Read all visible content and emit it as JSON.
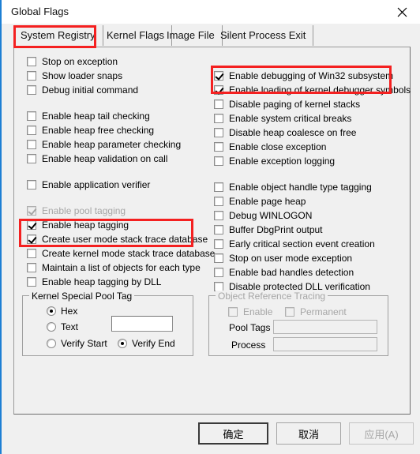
{
  "window": {
    "title": "Global Flags",
    "close_icon": "close-icon"
  },
  "tabs": [
    {
      "label": "System Registry",
      "selected": true
    },
    {
      "label": "Kernel Flags",
      "selected": false
    },
    {
      "label": "Image File",
      "selected": false
    },
    {
      "label": "Silent Process Exit",
      "selected": false
    }
  ],
  "left_column": [
    {
      "label": "Stop on exception",
      "checked": false,
      "enabled": true
    },
    {
      "label": "Show loader snaps",
      "checked": false,
      "enabled": true
    },
    {
      "label": "Debug initial command",
      "checked": false,
      "enabled": true
    },
    {
      "label": "Enable heap tail checking",
      "checked": false,
      "enabled": true
    },
    {
      "label": "Enable heap free checking",
      "checked": false,
      "enabled": true
    },
    {
      "label": "Enable heap parameter checking",
      "checked": false,
      "enabled": true
    },
    {
      "label": "Enable heap validation on call",
      "checked": false,
      "enabled": true
    },
    {
      "label": "Enable application verifier",
      "checked": false,
      "enabled": true
    },
    {
      "label": "Enable pool tagging",
      "checked": true,
      "enabled": false
    },
    {
      "label": "Enable heap tagging",
      "checked": true,
      "enabled": true
    },
    {
      "label": "Create user mode stack trace database",
      "checked": true,
      "enabled": true
    },
    {
      "label": "Create kernel mode stack trace database",
      "checked": false,
      "enabled": true
    },
    {
      "label": "Maintain a list of objects for each type",
      "checked": false,
      "enabled": true
    },
    {
      "label": "Enable heap tagging by DLL",
      "checked": false,
      "enabled": true
    }
  ],
  "right_column": [
    {
      "label": "Enable debugging of Win32 subsystem",
      "checked": true,
      "enabled": true
    },
    {
      "label": "Enable loading of kernel debugger symbols",
      "checked": true,
      "enabled": true
    },
    {
      "label": "Disable paging of kernel stacks",
      "checked": false,
      "enabled": true
    },
    {
      "label": "Enable system critical breaks",
      "checked": false,
      "enabled": true
    },
    {
      "label": "Disable heap coalesce on free",
      "checked": false,
      "enabled": true
    },
    {
      "label": "Enable close exception",
      "checked": false,
      "enabled": true
    },
    {
      "label": "Enable exception logging",
      "checked": false,
      "enabled": true
    },
    {
      "label": "Enable object handle type tagging",
      "checked": false,
      "enabled": true
    },
    {
      "label": "Enable page heap",
      "checked": false,
      "enabled": true
    },
    {
      "label": "Debug WINLOGON",
      "checked": false,
      "enabled": true
    },
    {
      "label": "Buffer DbgPrint output",
      "checked": false,
      "enabled": true
    },
    {
      "label": "Early critical section event creation",
      "checked": false,
      "enabled": true
    },
    {
      "label": "Stop on user mode exception",
      "checked": false,
      "enabled": true
    },
    {
      "label": "Enable bad handles detection",
      "checked": false,
      "enabled": true
    },
    {
      "label": "Disable protected DLL verification",
      "checked": false,
      "enabled": true
    }
  ],
  "kernel_pool": {
    "title": "Kernel Special Pool Tag",
    "radio_hex": "Hex",
    "radio_text": "Text",
    "radio_verify_start": "Verify Start",
    "radio_verify_end": "Verify End",
    "tag_value": "",
    "selected_format": "Hex",
    "selected_verify": "Verify End"
  },
  "object_tracing": {
    "title": "Object Reference Tracing",
    "enable_label": "Enable",
    "permanent_label": "Permanent",
    "pool_tags_label": "Pool Tags",
    "process_label": "Process",
    "pool_tags_value": "",
    "process_value": "",
    "enabled": false
  },
  "buttons": {
    "ok": "确定",
    "cancel": "取消",
    "apply": "应用(A)"
  },
  "annotations": {
    "accent_color": "#f42020",
    "highlight_tab": "System Registry",
    "highlight_right_group": "Enable debugging of Win32 subsystem / Enable loading of kernel debugger symbols",
    "highlight_left_group": "Enable heap tagging / Create user mode stack trace database"
  }
}
